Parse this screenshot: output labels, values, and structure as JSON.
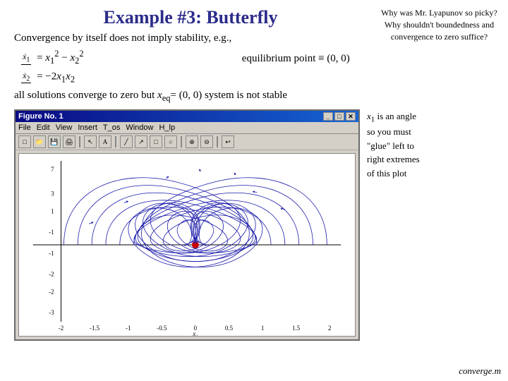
{
  "title": "Example #3: Butterfly",
  "convergence_text": "Convergence by itself does not imply stability, e.g.,",
  "top_right_note": "Why was Mr. Lyapunov so picky? Why shouldn't boundedness and convergence to zero suffice?",
  "equations": [
    "ẋ₁ = x₁² − x₂²",
    "ẋ₂ = −2x₁x₂"
  ],
  "equilibrium_text": "equilibrium point ≡ (0, 0)",
  "solutions_text": "all solutions converge to zero but",
  "solutions_xeq": "x",
  "solutions_eq_sub": "eq",
  "solutions_suffix": "= (0, 0) system is not stable",
  "figure_title": "Figure No. 1",
  "menu_items": [
    "File",
    "Edit",
    "View",
    "Insert",
    "Tools",
    "Window",
    "Help"
  ],
  "window_controls": [
    "_",
    "□",
    "✕"
  ],
  "right_note_line1": "x₁ is an angle",
  "right_note_line2": "so you must",
  "right_note_line3": "\"glue\" left to",
  "right_note_line4": "right extremes",
  "right_note_line5": "of this plot",
  "converge_note": "converge.m",
  "colors": {
    "title": "#2b2b8b",
    "titlebar_start": "#0a0a82",
    "titlebar_end": "#1564d4",
    "accent": "#cc0000",
    "plot_dot": "#cc0000",
    "arrow": "#1a1aaa"
  }
}
